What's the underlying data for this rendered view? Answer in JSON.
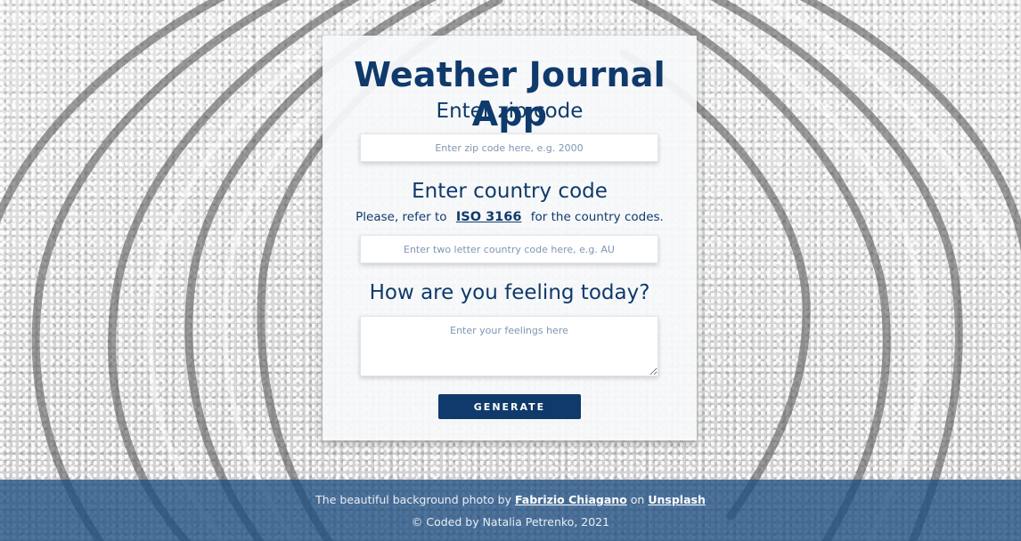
{
  "app": {
    "title": "Weather Journal App"
  },
  "zip": {
    "heading": "Enter zip code",
    "placeholder": "Enter zip code here, e.g. 2000",
    "value": ""
  },
  "country": {
    "heading": "Enter country code",
    "note_prefix": "Please, refer to",
    "note_link": "ISO 3166",
    "note_suffix": "for the country codes.",
    "placeholder": "Enter two letter country code here, e.g. AU",
    "value": ""
  },
  "feelings": {
    "heading": "How are you feeling today?",
    "placeholder": "Enter your feelings here",
    "value": ""
  },
  "actions": {
    "generate_label": "GENERATE"
  },
  "footer": {
    "credit_prefix": "The beautiful background photo by",
    "photographer": "Fabrizio Chiagano",
    "credit_middle": "on",
    "source": "Unsplash",
    "copyright": "© Coded by Natalia Petrenko, 2021"
  },
  "colors": {
    "brand": "#0f3a6b",
    "footer_bg": "#1e4e82",
    "card_bg": "#f8f9fb",
    "placeholder": "#7f95b3"
  }
}
